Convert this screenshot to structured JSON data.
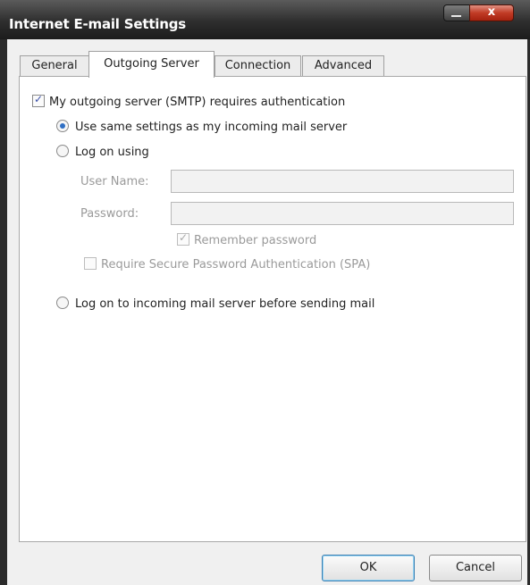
{
  "window": {
    "title": "Internet E-mail Settings",
    "close_glyph": "x"
  },
  "tabs": [
    {
      "label": "General",
      "active": false
    },
    {
      "label": "Outgoing Server",
      "active": true
    },
    {
      "label": "Connection",
      "active": false
    },
    {
      "label": "Advanced",
      "active": false
    }
  ],
  "outgoing": {
    "requires_auth_label": "My outgoing server (SMTP) requires authentication",
    "requires_auth_checked": true,
    "same_settings_label": "Use same settings as my incoming mail server",
    "log_on_using_label": "Log on using",
    "user_name_label": "User Name:",
    "user_name_value": "",
    "password_label": "Password:",
    "password_value": "",
    "remember_password_label": "Remember password",
    "remember_password_checked": true,
    "spa_label": "Require Secure Password Authentication (SPA)",
    "spa_checked": false,
    "log_on_incoming_label": "Log on to incoming mail server before sending mail",
    "selected_option": "same_settings"
  },
  "buttons": {
    "ok": "OK",
    "cancel": "Cancel"
  },
  "colors": {
    "titlebar": "#2e2e2e",
    "dialog_bg": "#f0f0f0",
    "close_button": "#c13b25",
    "radio_dot": "#2f6fc4"
  },
  "icons": {
    "close": "close-icon",
    "minimize": "minimize-icon"
  }
}
